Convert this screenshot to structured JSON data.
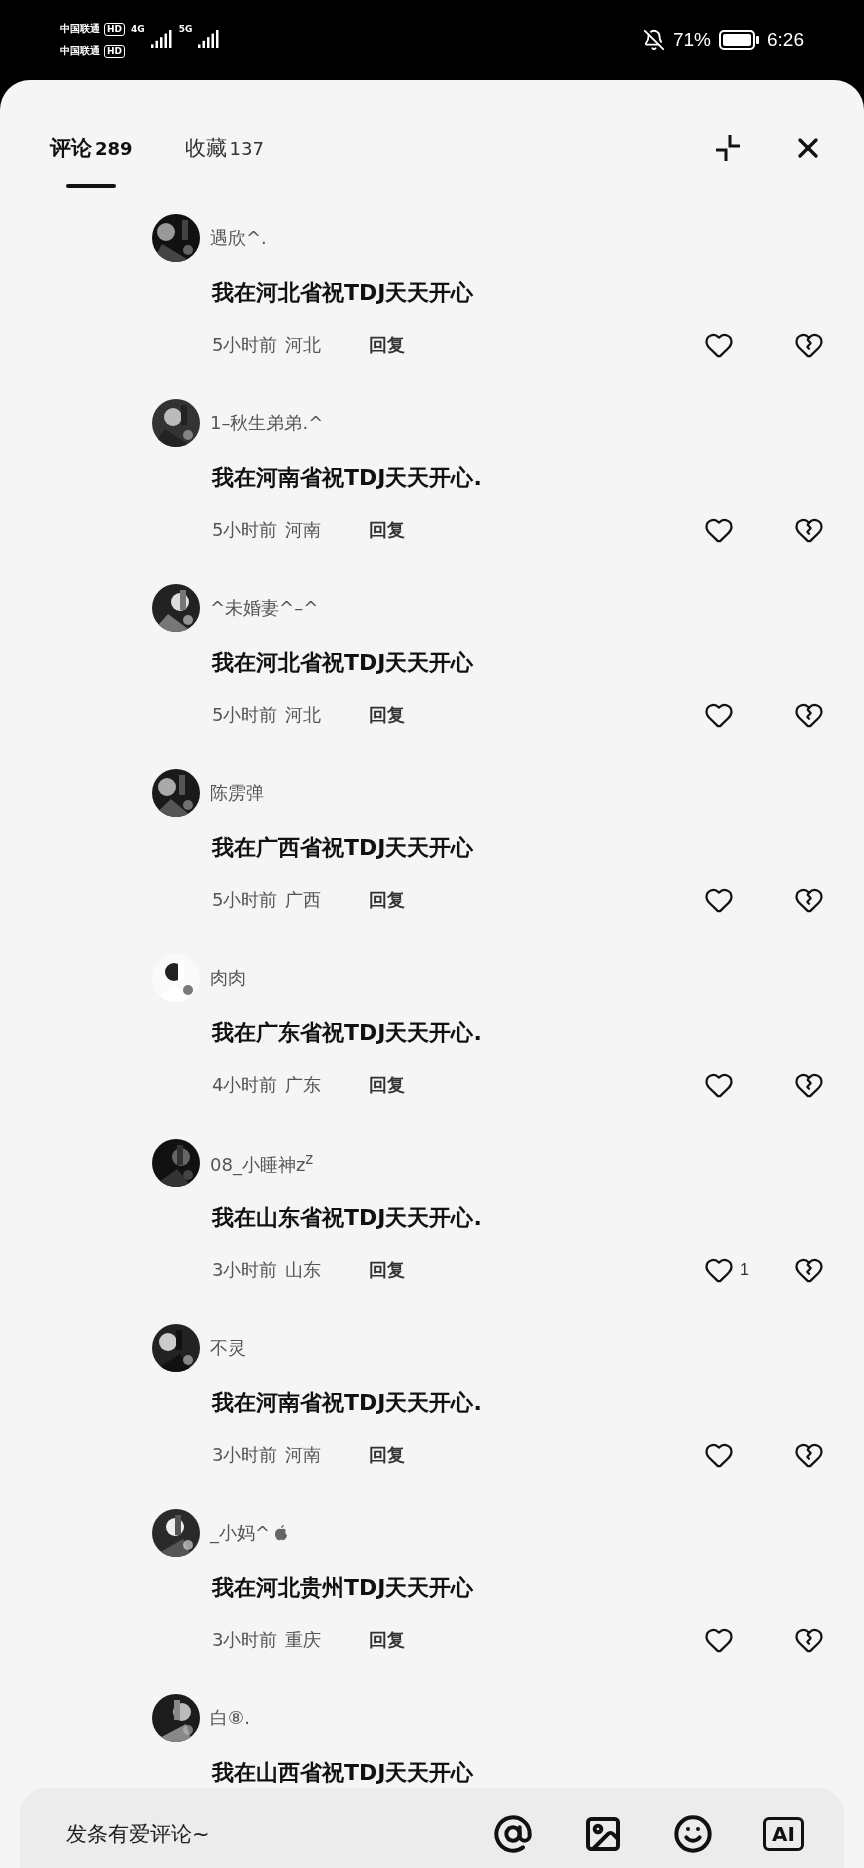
{
  "status_bar": {
    "carriers": [
      {
        "name": "中国联通",
        "badge": "HD"
      },
      {
        "name": "中国联通",
        "badge": "HD"
      }
    ],
    "networks": [
      "4G",
      "5G"
    ],
    "battery": "71%",
    "time": "6:26"
  },
  "tabs": [
    {
      "label": "评论",
      "count": "289",
      "selected": true
    },
    {
      "label": "收藏",
      "count": "137",
      "selected": false
    }
  ],
  "comments": [
    {
      "user": "遇欣^.",
      "text": "我在河北省祝TDJ天天开心",
      "time": "5小时前",
      "location": "河北",
      "reply": "回复",
      "badge": false
    },
    {
      "user": "1–秋生弟弟.^",
      "text": "我在河南省祝TDJ天天开心.",
      "time": "5小时前",
      "location": "河南",
      "reply": "回复",
      "badge": false
    },
    {
      "user": "^未婚妻^–^",
      "text": "我在河北省祝TDJ天天开心",
      "time": "5小时前",
      "location": "河北",
      "reply": "回复",
      "badge": false
    },
    {
      "user": "陈雳弹",
      "text": "我在广西省祝TDJ天天开心",
      "time": "5小时前",
      "location": "广西",
      "reply": "回复",
      "badge": false
    },
    {
      "user": "肉肉",
      "text": "我在广东省祝TDJ天天开心.",
      "time": "4小时前",
      "location": "广东",
      "reply": "回复",
      "badge": false
    },
    {
      "user": "08_小睡神z$^{z}$",
      "text": "我在山东省祝TDJ天天开心.",
      "time": "3小时前",
      "location": "山东",
      "reply": "回复",
      "likes": "1",
      "badge": false
    },
    {
      "user": "不灵",
      "text": "我在河南省祝TDJ天天开心.",
      "time": "3小时前",
      "location": "河南",
      "reply": "回复",
      "badge": false
    },
    {
      "user": "_小妈^",
      "text": "我在河北贵州TDJ天天开心",
      "time": "3小时前",
      "location": "重庆",
      "reply": "回复",
      "badge": true
    },
    {
      "user": "白⑧.",
      "text": "我在山西省祝TDJ天天开心",
      "badge": false
    }
  ],
  "composer": {
    "placeholder": "发条有爱评论~",
    "ai_label": "AI"
  }
}
